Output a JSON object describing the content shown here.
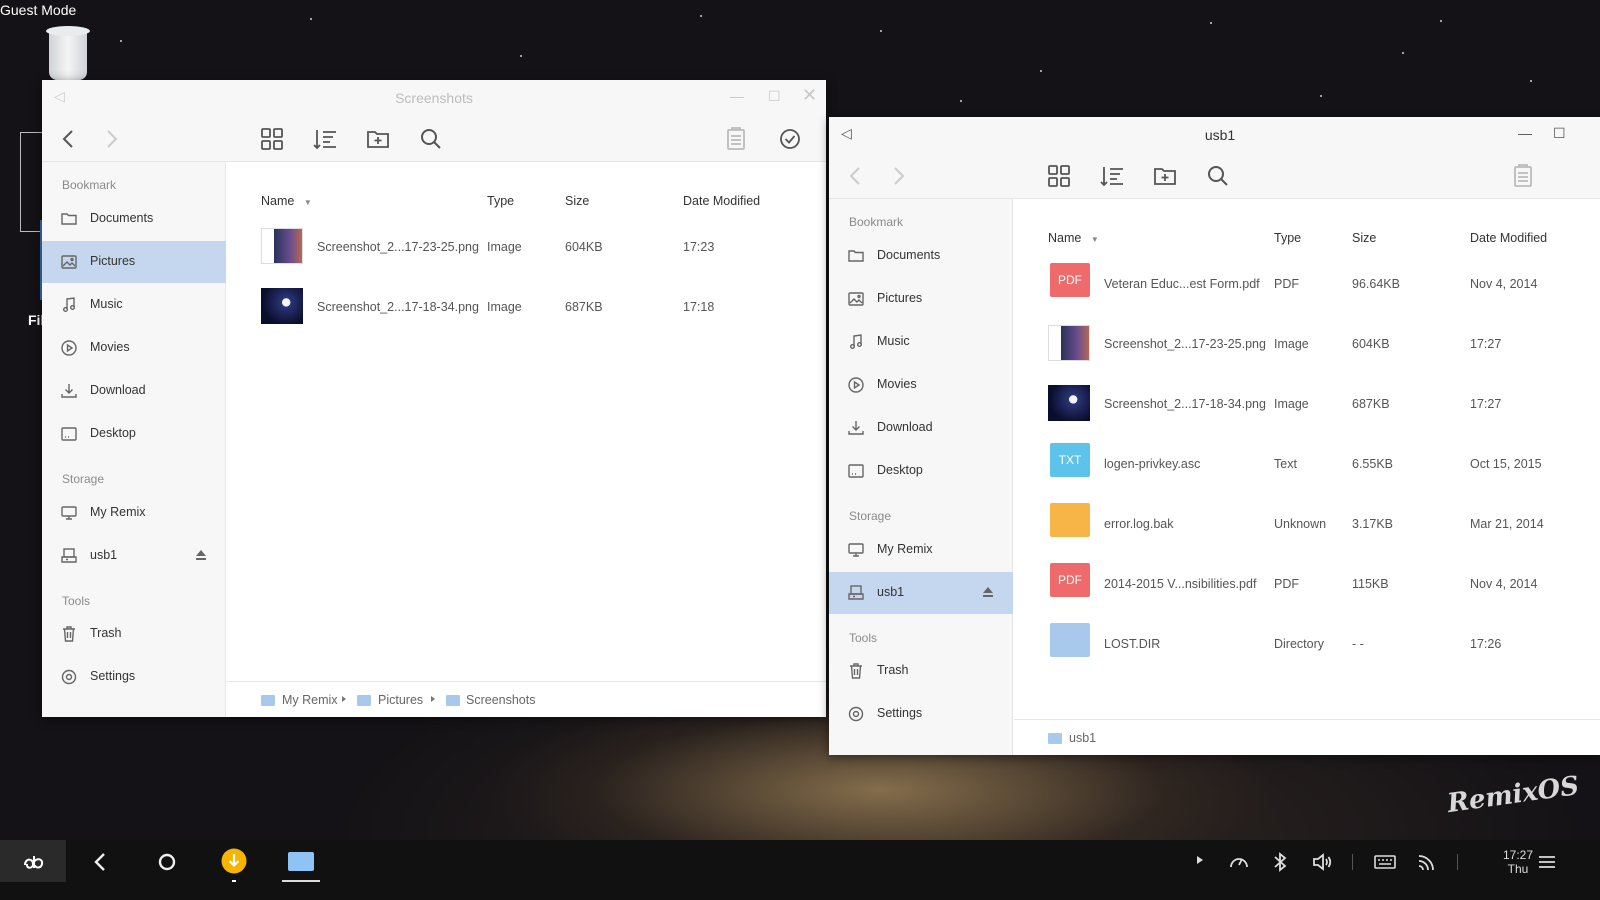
{
  "desktop": {
    "guest_label": "Guest Mode",
    "trash_icon": "trash-can-icon",
    "partial_label": "Fil",
    "logo": "RemixOS"
  },
  "window_left": {
    "title": "Screenshots",
    "sidebar": {
      "bookmark_label": "Bookmark",
      "bookmarks": [
        {
          "label": "Documents",
          "icon": "folder-icon"
        },
        {
          "label": "Pictures",
          "icon": "picture-icon",
          "active": true
        },
        {
          "label": "Music",
          "icon": "music-note-icon"
        },
        {
          "label": "Movies",
          "icon": "play-circle-icon"
        },
        {
          "label": "Download",
          "icon": "download-icon"
        },
        {
          "label": "Desktop",
          "icon": "desktop-icon"
        }
      ],
      "storage_label": "Storage",
      "storage": [
        {
          "label": "My Remix",
          "icon": "monitor-icon"
        },
        {
          "label": "usb1",
          "icon": "usb-drive-icon",
          "eject": true
        }
      ],
      "tools_label": "Tools",
      "tools": [
        {
          "label": "Trash",
          "icon": "trash-icon"
        },
        {
          "label": "Settings",
          "icon": "settings-icon"
        }
      ]
    },
    "columns": {
      "name": "Name",
      "type": "Type",
      "size": "Size",
      "date": "Date Modified"
    },
    "files": [
      {
        "name": "Screenshot_2...17-23-25.png",
        "type": "Image",
        "size": "604KB",
        "date": "17:23"
      },
      {
        "name": "Screenshot_2...17-18-34.png",
        "type": "Image",
        "size": "687KB",
        "date": "17:18"
      }
    ],
    "breadcrumb": [
      "My Remix",
      "Pictures",
      "Screenshots"
    ]
  },
  "window_right": {
    "title": "usb1",
    "sidebar": {
      "bookmark_label": "Bookmark",
      "bookmarks": [
        {
          "label": "Documents",
          "icon": "folder-icon"
        },
        {
          "label": "Pictures",
          "icon": "picture-icon"
        },
        {
          "label": "Music",
          "icon": "music-note-icon"
        },
        {
          "label": "Movies",
          "icon": "play-circle-icon"
        },
        {
          "label": "Download",
          "icon": "download-icon"
        },
        {
          "label": "Desktop",
          "icon": "desktop-icon"
        }
      ],
      "storage_label": "Storage",
      "storage": [
        {
          "label": "My Remix",
          "icon": "monitor-icon"
        },
        {
          "label": "usb1",
          "icon": "usb-drive-icon",
          "eject": true,
          "active": true
        }
      ],
      "tools_label": "Tools",
      "tools": [
        {
          "label": "Trash",
          "icon": "trash-icon"
        },
        {
          "label": "Settings",
          "icon": "settings-icon"
        }
      ]
    },
    "columns": {
      "name": "Name",
      "type": "Type",
      "size": "Size",
      "date": "Date Modified"
    },
    "files": [
      {
        "name": "Veteran Educ...est Form.pdf",
        "type": "PDF",
        "size": "96.64KB",
        "date": "Nov 4, 2014",
        "badge": "PDF",
        "color": "#ef6b6b"
      },
      {
        "name": "Screenshot_2...17-23-25.png",
        "type": "Image",
        "size": "604KB",
        "date": "17:27",
        "thumb": "light"
      },
      {
        "name": "Screenshot_2...17-18-34.png",
        "type": "Image",
        "size": "687KB",
        "date": "17:27",
        "thumb": "dark"
      },
      {
        "name": "logen-privkey.asc",
        "type": "Text",
        "size": "6.55KB",
        "date": "Oct 15, 2015",
        "badge": "TXT",
        "color": "#5ec3ea"
      },
      {
        "name": "error.log.bak",
        "type": "Unknown",
        "size": "3.17KB",
        "date": "Mar 21, 2014",
        "badge": "",
        "color": "#f6b546"
      },
      {
        "name": "2014-2015 V...nsibilities.pdf",
        "type": "PDF",
        "size": "115KB",
        "date": "Nov 4, 2014",
        "badge": "PDF",
        "color": "#ef6b6b"
      },
      {
        "name": "LOST.DIR",
        "type": "Directory",
        "size": "- -",
        "date": "17:26",
        "badge": "",
        "color": "#a9c9ec",
        "folder": true
      }
    ],
    "breadcrumb": [
      "usb1"
    ]
  },
  "taskbar": {
    "clock_time": "17:27",
    "clock_day": "Thu"
  }
}
